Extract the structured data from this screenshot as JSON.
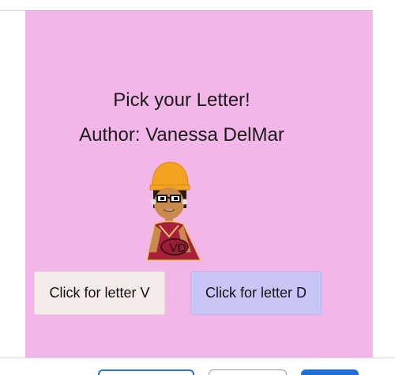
{
  "stage": {
    "title": "Pick your Letter!",
    "author": "Author: Vanessa DelMar",
    "background": "#f2b7e8"
  },
  "avatar": {
    "initials": "VD",
    "icon": "character-avatar-icon"
  },
  "buttons": {
    "letter_v": "Click for letter V",
    "letter_d": "Click for letter D"
  },
  "colors": {
    "button_v": "#f5ece9",
    "button_d": "#c8c6f6",
    "accent_blue": "#1e6fd9"
  }
}
